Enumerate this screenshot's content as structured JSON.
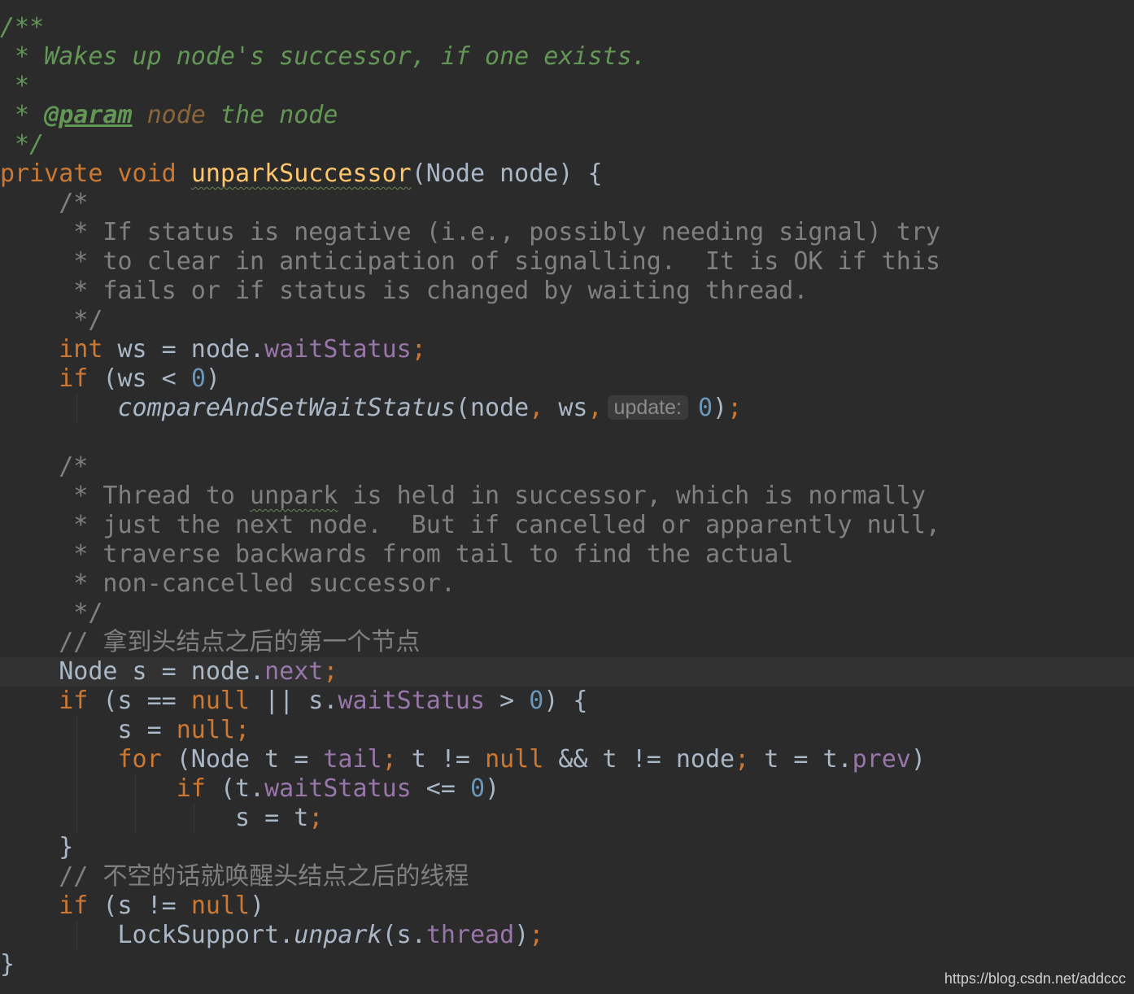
{
  "code": {
    "doc_open": "/**",
    "doc_line1": " * Wakes up node's successor, if one exists.",
    "doc_line2": " *",
    "doc_line3_prefix": " * ",
    "doc_line3_tag": "@param",
    "doc_line3_param": "node",
    "doc_line3_rest": " the node",
    "doc_close": " */",
    "sig_modifiers": "private void ",
    "sig_method": "unparkSuccessor",
    "sig_params": "(Node node) {",
    "c1_open": "    /*",
    "c1_l1": "     * If status is negative (i.e., possibly needing signal) try",
    "c1_l2": "     * to clear in anticipation of signalling.  It is OK if this",
    "c1_l3": "     * fails or if status is changed by waiting thread.",
    "c1_close": "     */",
    "ws_indent": "    ",
    "ws_kw": "int",
    "ws_mid": " ws = node.",
    "ws_field": "waitStatus",
    "ws_semi": ";",
    "if1_indent": "    ",
    "if1_kw": "if",
    "if1_mid": " (ws < ",
    "if1_num": "0",
    "if1_end": ")",
    "cas_indent": "        ",
    "cas_method": "compareAndSetWaitStatus",
    "cas_args1": "(node",
    "cas_comma1": ",",
    "cas_args2": " ws",
    "cas_comma2": ",",
    "cas_hint": "update:",
    "cas_num": "0",
    "cas_close": ")",
    "cas_semi": ";",
    "c2_open": "    /*",
    "c2_l1_a": "     * Thread to ",
    "c2_l1_b": "unpark",
    "c2_l1_c": " is held in successor, which is normally",
    "c2_l2": "     * just the next node.  But if cancelled or apparently null,",
    "c2_l3": "     * traverse backwards from tail to find the actual",
    "c2_l4": "     * non-cancelled successor.",
    "c2_close": "     */",
    "cm1_prefix": "    // ",
    "cm1_text": "拿到头结点之后的第一个节点",
    "node_s_indent": "    ",
    "node_s_mid": "Node s = node.",
    "node_s_field": "next",
    "node_s_semi": ";",
    "if2_indent": "    ",
    "if2_kw": "if",
    "if2_a": " (s == ",
    "if2_null": "null",
    "if2_b": " || s.",
    "if2_field": "waitStatus",
    "if2_c": " > ",
    "if2_num": "0",
    "if2_d": ") {",
    "s_null_indent": "        ",
    "s_null_a": "s = ",
    "s_null_kw": "null",
    "s_null_semi": ";",
    "for_indent": "        ",
    "for_kw": "for",
    "for_a": " (Node t = ",
    "for_tail": "tail",
    "for_semi1": ";",
    "for_b": " t != ",
    "for_null": "null",
    "for_c": " && t != node",
    "for_semi2": ";",
    "for_d": " t = t.",
    "for_prev": "prev",
    "for_e": ")",
    "if3_indent": "            ",
    "if3_kw": "if",
    "if3_a": " (t.",
    "if3_field": "waitStatus",
    "if3_b": " <= ",
    "if3_num": "0",
    "if3_c": ")",
    "s_t_indent": "                ",
    "s_t_a": "s = t",
    "s_t_semi": ";",
    "brace_close_if2": "    }",
    "cm2_prefix": "    // ",
    "cm2_text": "不空的话就唤醒头结点之后的线程",
    "if4_indent": "    ",
    "if4_kw": "if",
    "if4_a": " (s != ",
    "if4_null": "null",
    "if4_b": ")",
    "ls_indent": "        ",
    "ls_a": "LockSupport.",
    "ls_method": "unpark",
    "ls_b": "(s.",
    "ls_field": "thread",
    "ls_c": ")",
    "ls_semi": ";",
    "brace_close_method": "}"
  },
  "watermark": "https://blog.csdn.net/addccc",
  "colors": {
    "background": "#2b2b2b",
    "keyword": "#cc7832",
    "method_decl": "#ffc66d",
    "field": "#9876aa",
    "number": "#6897bb",
    "doc_comment": "#629755",
    "comment": "#808080",
    "text": "#a9b7c6"
  }
}
